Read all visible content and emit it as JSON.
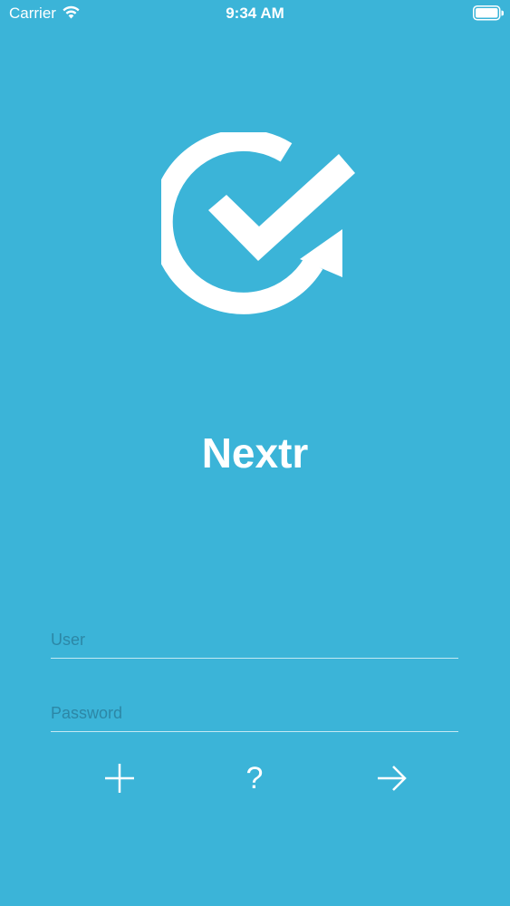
{
  "status_bar": {
    "carrier": "Carrier",
    "time": "9:34 AM"
  },
  "app": {
    "title": "Nextr",
    "background_color": "#3bb4d8",
    "logo_icon": "check-refresh-icon"
  },
  "login_form": {
    "user_placeholder": "User",
    "user_value": "",
    "password_placeholder": "Password",
    "password_value": ""
  },
  "actions": {
    "add_icon": "plus-icon",
    "help_label": "?",
    "login_icon": "arrow-right-icon"
  }
}
